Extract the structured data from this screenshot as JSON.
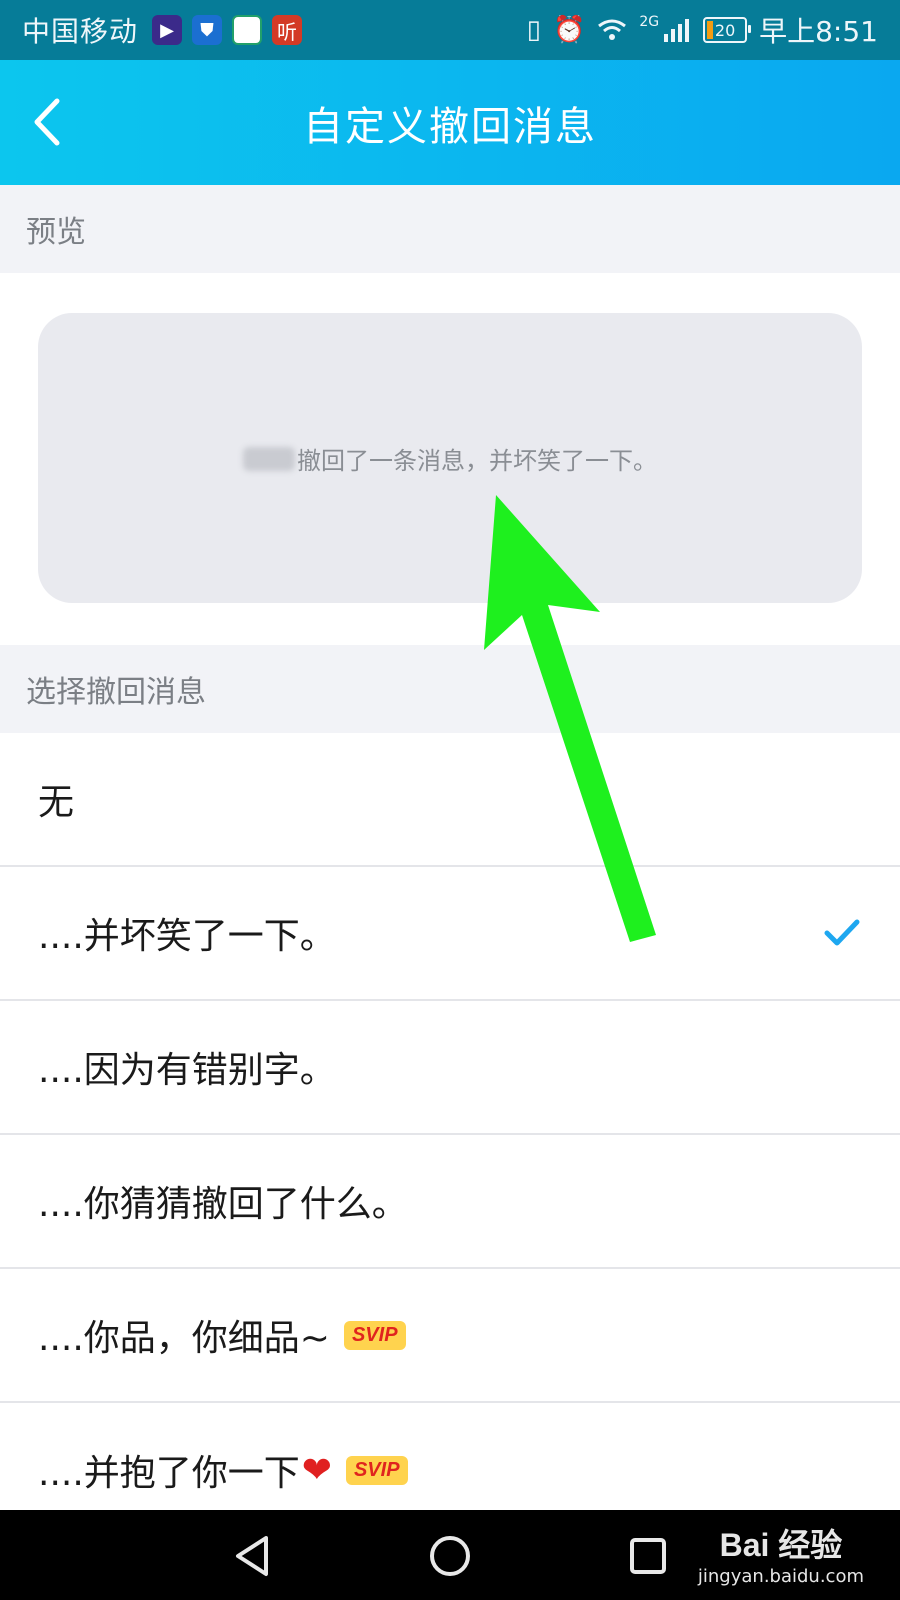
{
  "status_bar": {
    "carrier": "中国移动",
    "app_icons": [
      {
        "name": "video-app-icon",
        "glyph": "▶"
      },
      {
        "name": "shield-app-icon",
        "glyph": "⛊"
      },
      {
        "name": "photo-app-icon",
        "glyph": "◎"
      },
      {
        "name": "listen-app-icon",
        "glyph": "听"
      }
    ],
    "vibrate_icon": "▯",
    "alarm_icon": "⏰",
    "wifi_icon": "wifi",
    "network": "2G",
    "battery": "20",
    "time": "早上8:51"
  },
  "header": {
    "title": "自定义撤回消息",
    "back_icon": "chevron-left-icon",
    "color_start": "#0cc6ee",
    "color_end": "#0aa8f0"
  },
  "preview_section": {
    "label": "预览",
    "message": "撤回了一条消息，并坏笑了一下。"
  },
  "options_section": {
    "label": "选择撤回消息",
    "items": [
      {
        "label": "无",
        "selected": false,
        "badge": ""
      },
      {
        "label": "....并坏笑了一下。",
        "selected": true,
        "badge": ""
      },
      {
        "label": "....因为有错别字。",
        "selected": false,
        "badge": ""
      },
      {
        "label": "....你猜猜撤回了什么。",
        "selected": false,
        "badge": ""
      },
      {
        "label": "....你品，你细品~",
        "selected": false,
        "badge": "SVIP"
      },
      {
        "label": "....并抱了你一下",
        "heart": "❤",
        "selected": false,
        "badge": "SVIP"
      }
    ]
  },
  "check_color": "#1ea7f0",
  "annotation_color": "#1ef01e",
  "watermark": {
    "main": "Bai 经验",
    "sub": "jingyan.baidu.com"
  }
}
